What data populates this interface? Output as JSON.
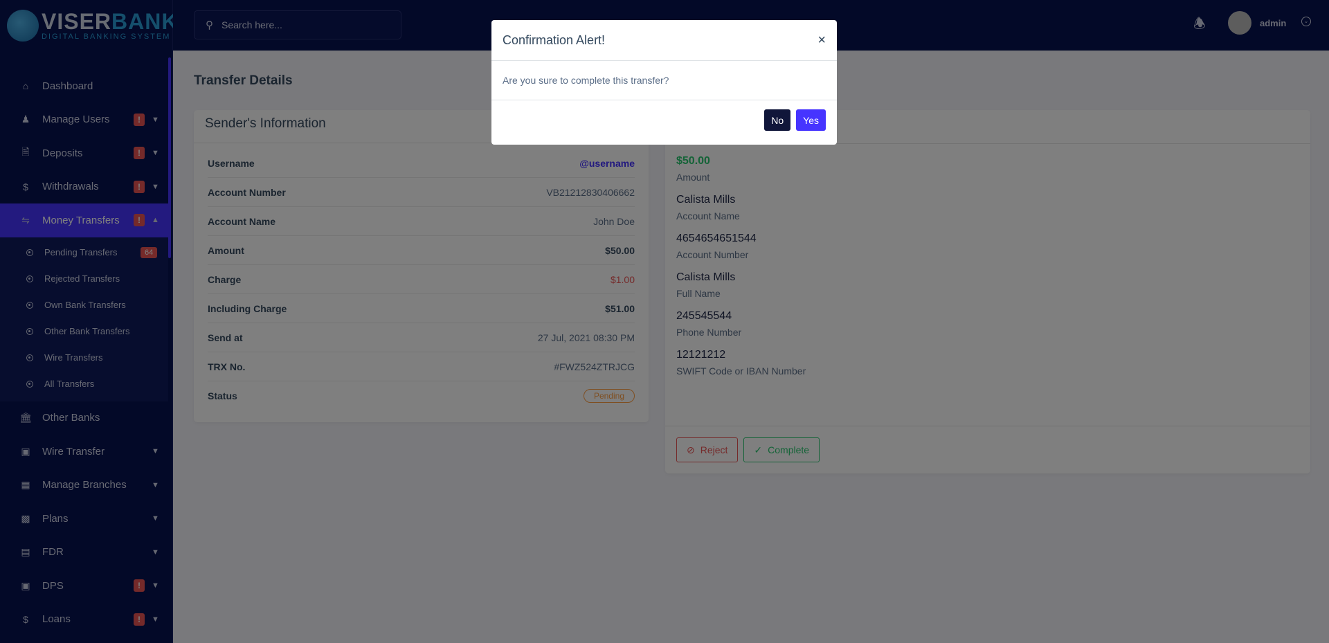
{
  "brand": {
    "name_a": "VISER",
    "name_b": "BANK",
    "tagline": "DIGITAL BANKING SYSTEM"
  },
  "search": {
    "placeholder": "Search here..."
  },
  "user": {
    "name": "admin"
  },
  "sidebar": {
    "items": [
      {
        "label": "Dashboard",
        "icon": "home-icon",
        "alert": false,
        "chevron": false
      },
      {
        "label": "Manage Users",
        "icon": "users-icon",
        "alert": true,
        "chevron": true
      },
      {
        "label": "Deposits",
        "icon": "invoice-dollar-icon",
        "alert": true,
        "chevron": true
      },
      {
        "label": "Withdrawals",
        "icon": "hand-dollar-icon",
        "alert": true,
        "chevron": true
      },
      {
        "label": "Money Transfers",
        "icon": "shuffle-icon",
        "alert": true,
        "chevron": true,
        "active": true
      },
      {
        "label": "Other Banks",
        "icon": "bank-icon",
        "alert": false,
        "chevron": false
      },
      {
        "label": "Wire Transfer",
        "icon": "money-chat-icon",
        "alert": false,
        "chevron": true
      },
      {
        "label": "Manage Branches",
        "icon": "sitemap-icon",
        "alert": false,
        "chevron": true
      },
      {
        "label": "Plans",
        "icon": "bar-chart-icon",
        "alert": false,
        "chevron": true
      },
      {
        "label": "FDR",
        "icon": "money-bill-icon",
        "alert": false,
        "chevron": true
      },
      {
        "label": "DPS",
        "icon": "box-icon",
        "alert": true,
        "chevron": true
      },
      {
        "label": "Loans",
        "icon": "hand-dollar-icon",
        "alert": true,
        "chevron": true
      }
    ],
    "alert_text": "!",
    "submenu": [
      {
        "label": "Pending Transfers",
        "count": "64"
      },
      {
        "label": "Rejected Transfers"
      },
      {
        "label": "Own Bank Transfers"
      },
      {
        "label": "Other Bank Transfers"
      },
      {
        "label": "Wire Transfers"
      },
      {
        "label": "All Transfers"
      }
    ]
  },
  "page": {
    "title": "Transfer Details"
  },
  "sender": {
    "title": "Sender's Information",
    "rows": [
      {
        "k": "Username",
        "v": "@username"
      },
      {
        "k": "Account Number",
        "v": "VB21212830406662"
      },
      {
        "k": "Account Name",
        "v": "John Doe"
      },
      {
        "k": "Amount",
        "v": "$50.00"
      },
      {
        "k": "Charge",
        "v": "$1.00"
      },
      {
        "k": "Including Charge",
        "v": "$51.00"
      },
      {
        "k": "Send at",
        "v": "27 Jul, 2021 08:30 PM"
      },
      {
        "k": "TRX No.",
        "v": "#FWZ524ZTRJCG"
      },
      {
        "k": "Status",
        "v": "Pending"
      }
    ]
  },
  "recipient": {
    "items": [
      {
        "val": "$50.00",
        "lbl": "Amount"
      },
      {
        "val": "Calista Mills",
        "lbl": "Account Name"
      },
      {
        "val": "4654654651544",
        "lbl": "Account Number"
      },
      {
        "val": "Calista Mills",
        "lbl": "Full Name"
      },
      {
        "val": "245545544",
        "lbl": "Phone Number"
      },
      {
        "val": "12121212",
        "lbl": "SWIFT Code or IBAN Number"
      }
    ],
    "reject": "Reject",
    "complete": "Complete"
  },
  "modal": {
    "title": "Confirmation Alert!",
    "message": "Are you sure to complete this transfer?",
    "no": "No",
    "yes": "Yes"
  },
  "colors": {
    "accent": "#4634ff",
    "success": "#28c76f",
    "danger": "#ea5455",
    "warning": "#ff9f43",
    "sidebar": "#071251"
  }
}
